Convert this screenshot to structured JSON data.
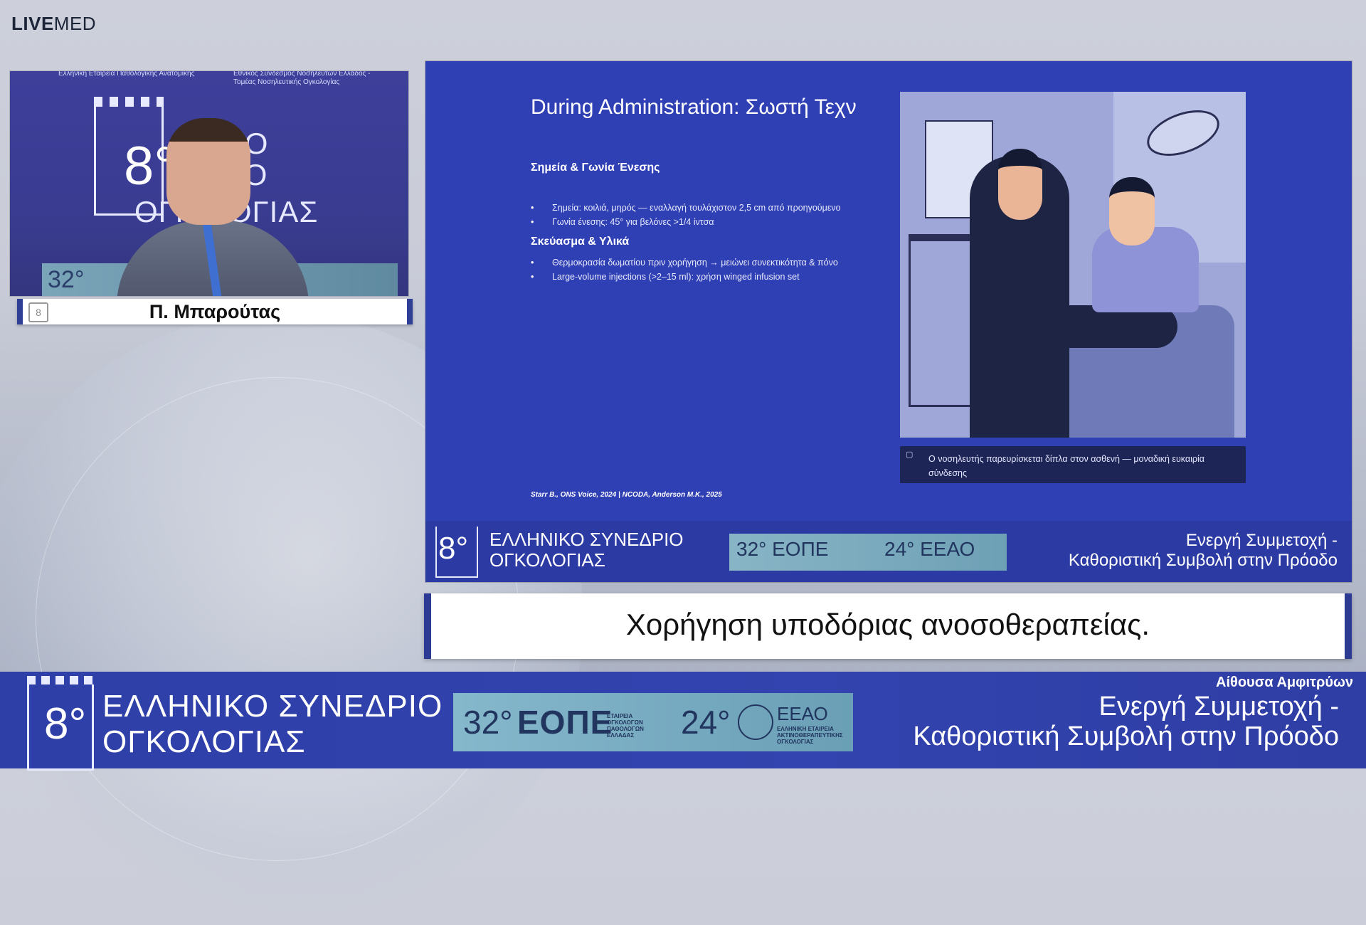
{
  "brand": {
    "live": "LIVE",
    "med": "MED"
  },
  "camera": {
    "top_left_text": "Ελληνική Εταιρεία Παθολογικής Ανατομικής",
    "top_right_text": "Εθνικός Σύνδεσμος Νοσηλευτών Ελλάδος -\nΤομέας Νοσηλευτικής Ογκολογίας",
    "bg_eight": "8°",
    "bg_line1": "ΝΙΚΟ",
    "bg_line2": "ΔΡΙΟ",
    "bg_line3": "ΟΓΚΟ ΟΓΙΑΣ",
    "bg_32": "32°"
  },
  "nameplate": {
    "name": "Π. Μπαρούτας",
    "logo_text": "8"
  },
  "slide": {
    "title": "During Administration: Σωστή Τεχν",
    "section1": "Σημεία & Γωνία Ένεσης",
    "bullets1": [
      "Σημεία: κοιλιά, μηρός — εναλλαγή τουλάχιστον 2,5 cm από προηγούμενο",
      "Γωνία ένεσης: 45° για βελόνες >1/4 ίντσα"
    ],
    "section2": "Σκεύασμα & Υλικά",
    "bullets2": [
      "Θερμοκρασία δωματίου πριν χορήγηση → μειώνει συνεκτικότητα & πόνο",
      "Large-volume injections (>2–15 ml): χρήση winged infusion set"
    ],
    "citation": "Starr B., ONS Voice, 2024 | NCODA, Anderson M.K., 2025",
    "caption": "Ο νοσηλευτής παρευρίσκεται δίπλα στον ασθενή — μοναδική ευκαιρία σύνδεσης",
    "band": {
      "eight": "8°",
      "name_line1": "ΕΛΛΗΝΙΚΟ ΣΥΝΕΔΡΙΟ",
      "name_line2": "ΟΓΚΟΛΟΓΙΑΣ",
      "mid_left": "32° ΕΟΠΕ",
      "mid_right": "24° ΕΕΑΟ",
      "motto_line1": "Ενεργή Συμμετοχή -",
      "motto_line2": "Καθοριστική Συμβολή στην Πρόοδο"
    }
  },
  "subtitle": "Χορήγηση υποδόριας ανοσοθεραπείας.",
  "banner": {
    "eight": "8°",
    "name_line1": "ΕΛΛΗΝΙΚΟ ΣΥΝΕΔΡΙΟ",
    "name_line2": "ΟΓΚΟΛΟΓΙΑΣ",
    "mid_32": "32°",
    "mid_eope": "ΕΟΠΕ",
    "mid_eope_small": "ΕΤΑΙΡΕΙΑ\nΟΓΚΟΛΟΓΩΝ\nΠΑΘΟΛΟΓΩΝ\nΕΛΛΑΔΑΣ",
    "mid_24": "24°",
    "mid_eeao": "ΕΕΑΟ",
    "mid_eeao_small": "ΕΛΛΗΝΙΚΗ ΕΤΑΙΡΕΙΑ\nΑΚΤΙΝΟΘΕΡΑΠΕΥΤΙΚΗΣ\nΟΓΚΟΛΟΓΙΑΣ",
    "room": "Αίθουσα Αμφιτρύων",
    "motto_line1": "Ενεργή Συμμετοχή -",
    "motto_line2": "Καθοριστική Συμβολή στην Πρόοδο"
  }
}
